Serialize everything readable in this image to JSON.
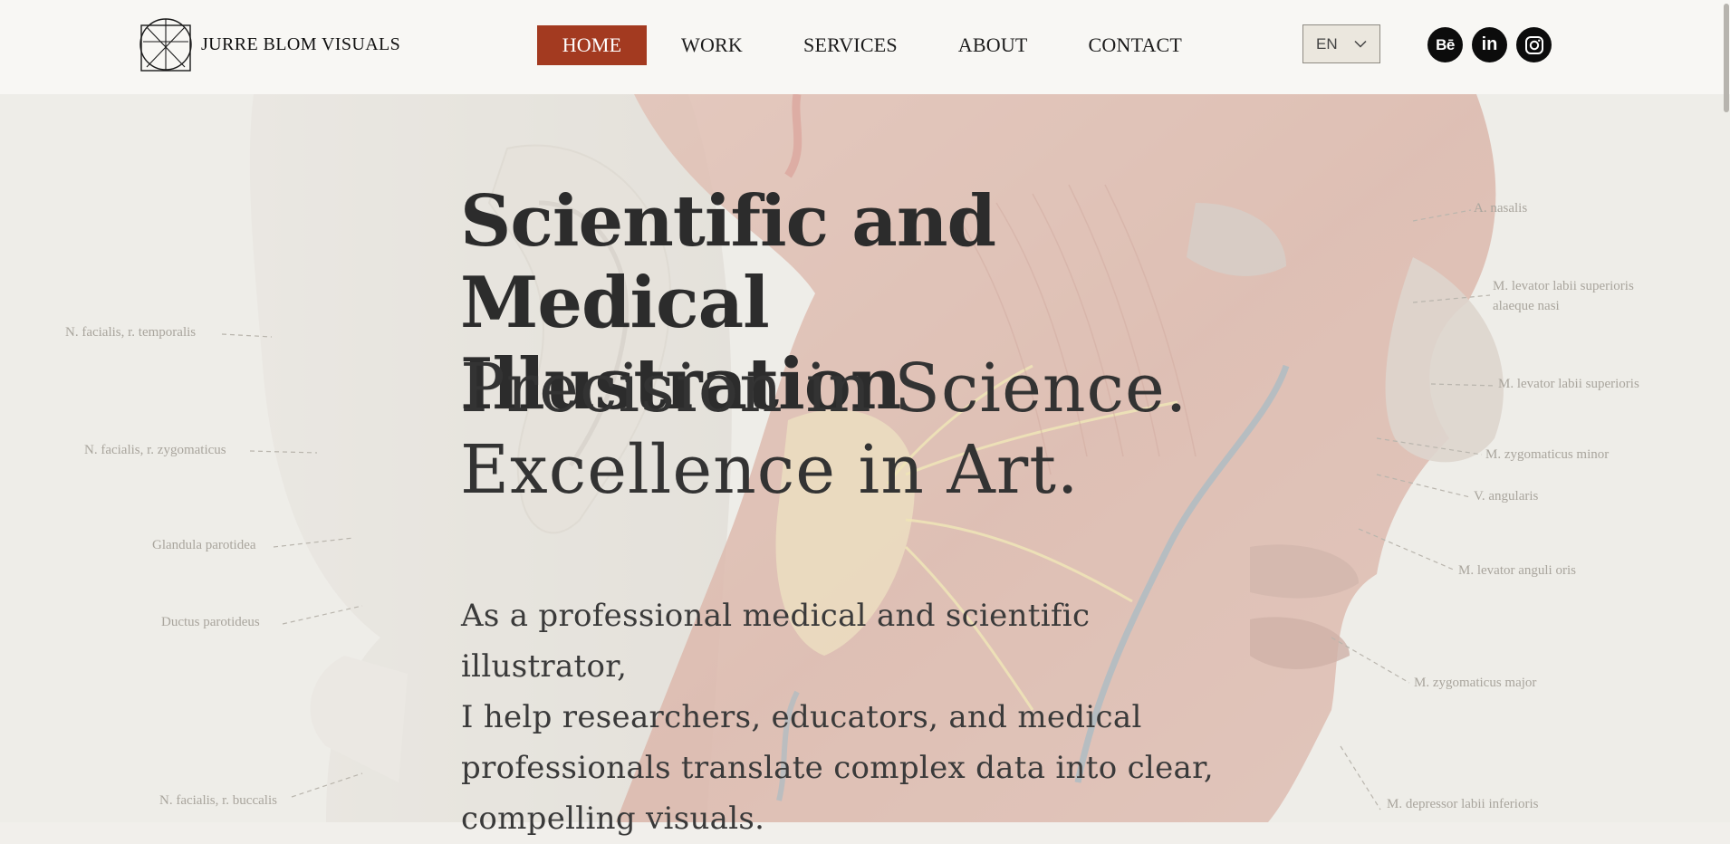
{
  "brand": {
    "name": "JURRE BLOM VISUALS",
    "logo_icon": "vitruvian-square-circle-logo"
  },
  "nav": {
    "items": [
      {
        "label": "HOME",
        "active": true
      },
      {
        "label": "WORK",
        "active": false
      },
      {
        "label": "SERVICES",
        "active": false
      },
      {
        "label": "ABOUT",
        "active": false
      },
      {
        "label": "CONTACT",
        "active": false
      }
    ],
    "active_color": "#a33a20"
  },
  "language": {
    "selected": "EN",
    "icon": "chevron-down-icon"
  },
  "social": [
    {
      "name": "behance",
      "glyph": "Bē",
      "icon": "behance-icon"
    },
    {
      "name": "linkedin",
      "glyph": "in",
      "icon": "linkedin-icon"
    },
    {
      "name": "instagram",
      "icon": "instagram-icon"
    }
  ],
  "hero": {
    "title_line1": "Scientific and Medical",
    "title_line2": "Illustration",
    "subtitle_line1": "Precision in Science.",
    "subtitle_line2": "Excellence in Art.",
    "intro_lines": [
      "As a professional medical and scientific illustrator,",
      "I help researchers, educators, and medical",
      "professionals translate complex data into clear,",
      "compelling visuals."
    ],
    "background": "anatomical-head-illustration"
  },
  "anatomy_labels": [
    "A. nasalis",
    "M. levator labii superioris",
    "alaeque nasi",
    "M. levator labii superioris",
    "M. zygomaticus minor",
    "V. angularis",
    "M. levator anguli oris",
    "M. zygomaticus major",
    "M. depressor labii inferioris",
    "N. facialis, r. temporalis",
    "N. facialis, r. zygomaticus",
    "Glandula parotidea",
    "Ductus parotideus",
    "N. facialis, r. buccalis"
  ]
}
